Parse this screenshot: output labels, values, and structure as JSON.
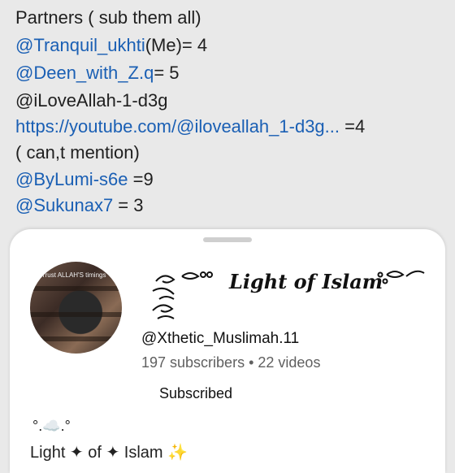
{
  "background_lines": [
    {
      "text": "Partners ( sub them all)",
      "link": false
    },
    {
      "link_text": "@Tranquil_ukhti",
      "rest": "(Me)=  4",
      "link": true
    },
    {
      "link_text": "@Deen_with_Z.q",
      "rest": "= 5",
      "link": true
    },
    {
      "text": "@iLoveAllah-1-d3g",
      "link": false
    },
    {
      "link_text": "https://youtube.com/@iloveallah_1-d3g...",
      "rest": " =4",
      "link": true
    },
    {
      "text": "( can,t mention)",
      "link": false
    },
    {
      "link_text": "@ByLumi-s6e",
      "rest": " =9",
      "link": true
    },
    {
      "link_text": "@Sukunax7",
      "rest": " = 3",
      "link": true
    }
  ],
  "sheet": {
    "avatar_caption": "Trust ALLAH'S timings",
    "brand_title": "Light of Islam",
    "handle": "@Xthetic_Muslimah.11",
    "subscribers": "197 subscribers",
    "videos": "22 videos",
    "meta_separator": " • ",
    "subscribed_label": "Subscribed",
    "desc_line1": "°.☁️.°",
    "desc_line2": "Light ✦ of ✦ Islam ✨"
  },
  "colors": {
    "link": "#1a5fb4",
    "background": "#e9e9e9",
    "sheet": "#ffffff"
  }
}
